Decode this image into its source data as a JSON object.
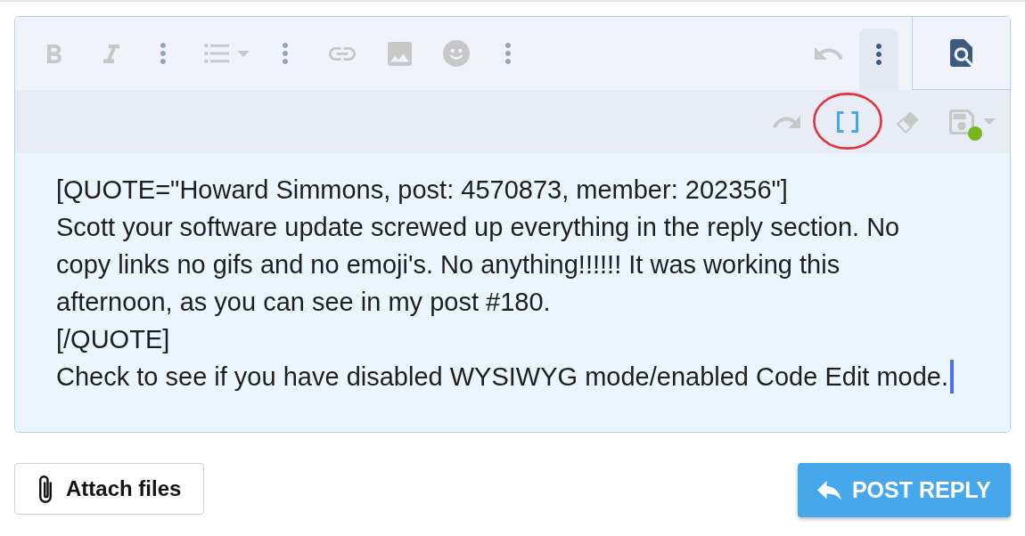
{
  "editor": {
    "toolbar": {
      "main": [
        {
          "kind": "bold",
          "disabled": true,
          "active": false,
          "circled": false
        },
        {
          "kind": "italic",
          "disabled": true,
          "active": false,
          "circled": false
        },
        {
          "kind": "more",
          "disabled": false,
          "active": false,
          "circled": false
        },
        {
          "kind": "list",
          "disabled": true,
          "active": false,
          "circled": false
        },
        {
          "kind": "more",
          "disabled": false,
          "active": false,
          "circled": false
        },
        {
          "kind": "link",
          "disabled": true,
          "active": false,
          "circled": false
        },
        {
          "kind": "image",
          "disabled": true,
          "active": false,
          "circled": false
        },
        {
          "kind": "emoji",
          "disabled": true,
          "active": false,
          "circled": false
        },
        {
          "kind": "more",
          "disabled": false,
          "active": false,
          "circled": false
        }
      ],
      "end": [
        {
          "kind": "undo",
          "disabled": true,
          "active": false,
          "circled": false
        },
        {
          "kind": "more",
          "disabled": false,
          "active": true,
          "circled": false
        }
      ],
      "more_row": [
        {
          "kind": "redo",
          "disabled": true,
          "active": false,
          "circled": false
        },
        {
          "kind": "code_view",
          "disabled": false,
          "active": true,
          "circled": true
        },
        {
          "kind": "clear_formatting",
          "disabled": true,
          "active": false,
          "circled": false
        },
        {
          "kind": "drafts",
          "disabled": true,
          "active": false,
          "circled": false
        }
      ]
    },
    "lines": [
      "[QUOTE=\"Howard Simmons, post: 4570873, member: 202356\"]",
      "Scott your software update screwed up everything in the reply section. No",
      "copy links no gifs and no emoji's. No anything!!!!!! It was working this",
      "afternoon, as you can see in my post #180.",
      "[/QUOTE]",
      "Check to see if you have disabled WYSIWYG mode/enabled Code Edit mode."
    ],
    "text_cursor": true
  },
  "buttons": [
    {
      "kind": "attach",
      "label": "Attach files"
    },
    {
      "kind": "submit",
      "label": "POST REPLY"
    }
  ]
}
